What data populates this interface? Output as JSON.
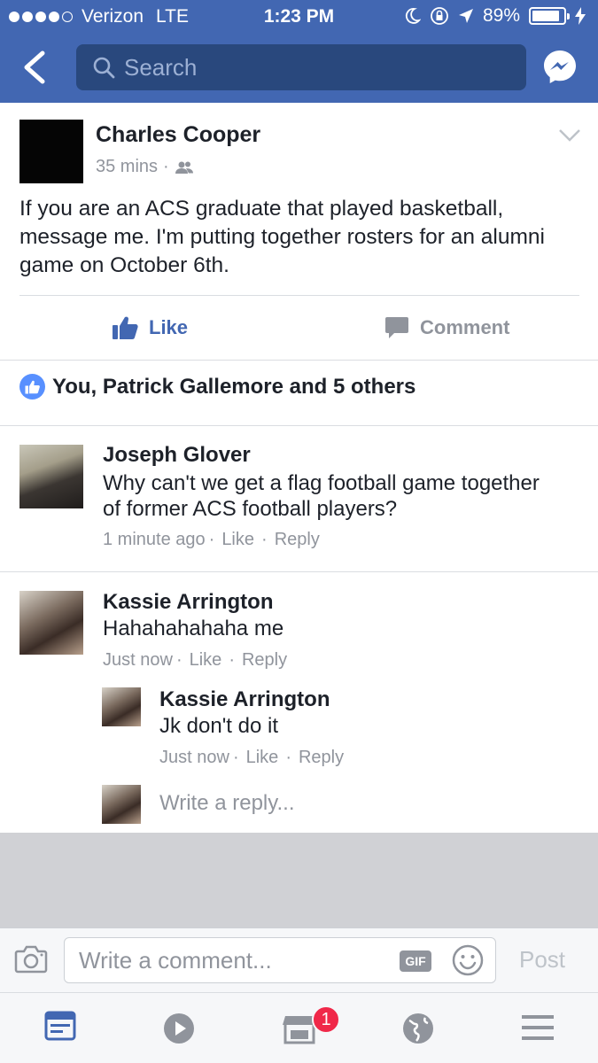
{
  "status_bar": {
    "carrier": "Verizon",
    "network": "LTE",
    "time": "1:23 PM",
    "battery": "89%",
    "battery_level": 0.89
  },
  "nav": {
    "search_placeholder": "Search"
  },
  "post": {
    "author": "Charles Cooper",
    "time": "35 mins",
    "dot": "·",
    "text": "If you are an ACS graduate that played basketball, message me. I'm putting together rosters for an alumni game on October 6th.",
    "like_label": "Like",
    "comment_label": "Comment",
    "reactions_summary": "You, Patrick Gallemore and 5 others"
  },
  "comments": [
    {
      "name": "Joseph Glover",
      "text": "Why can't we get a flag football game together of former ACS football players?",
      "time": "1 minute ago",
      "like": "Like",
      "reply": "Reply"
    },
    {
      "name": "Kassie Arrington",
      "text": "Hahahahahaha me",
      "time": "Just now",
      "like": "Like",
      "reply": "Reply"
    }
  ],
  "reply": {
    "name": "Kassie Arrington",
    "text": "Jk don't do it",
    "time": "Just now",
    "like": "Like",
    "reply": "Reply"
  },
  "write_reply_placeholder": "Write a reply...",
  "composer": {
    "placeholder": "Write a comment...",
    "gif_label": "GIF",
    "post_label": "Post"
  },
  "tabbar": {
    "marketplace_badge": "1"
  },
  "colors": {
    "brand_blue": "#4267b2",
    "search_bg": "#29487d",
    "badge_red": "#f02849"
  }
}
